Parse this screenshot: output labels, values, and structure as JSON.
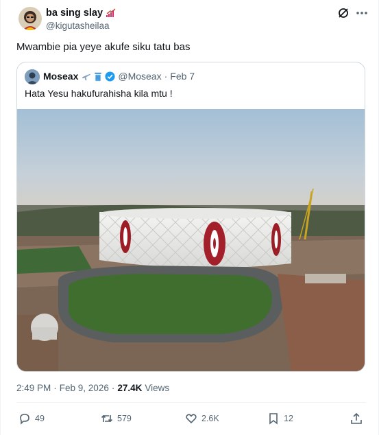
{
  "author": {
    "display_name": "ba sing slay",
    "name_emoji": "chart-increasing-emoji",
    "handle": "@kigutasheilaa"
  },
  "tweet_text": "Mwambie pia yeye akufe siku tatu bas",
  "quoted": {
    "display_name": "Moseax",
    "name_emojis": [
      "airplane-emoji",
      "trash-can-emoji"
    ],
    "verified": true,
    "handle": "@Moseax",
    "separator": "·",
    "date": "Feb 7",
    "text": "Hata Yesu hakufurahisha kila mtu !",
    "image": "aerial-view-of-stadium-under-construction"
  },
  "meta": {
    "time": "2:49 PM",
    "separator": "·",
    "date": "Feb 9, 2026",
    "separator2": "·",
    "views_count": "27.4K",
    "views_label": "Views"
  },
  "actions": {
    "replies": "49",
    "reposts": "579",
    "likes": "2.6K",
    "bookmarks": "12"
  },
  "colors": {
    "secondary_text": "#536471",
    "verified_blue": "#1d9bf0",
    "border": "#cfd9de"
  }
}
